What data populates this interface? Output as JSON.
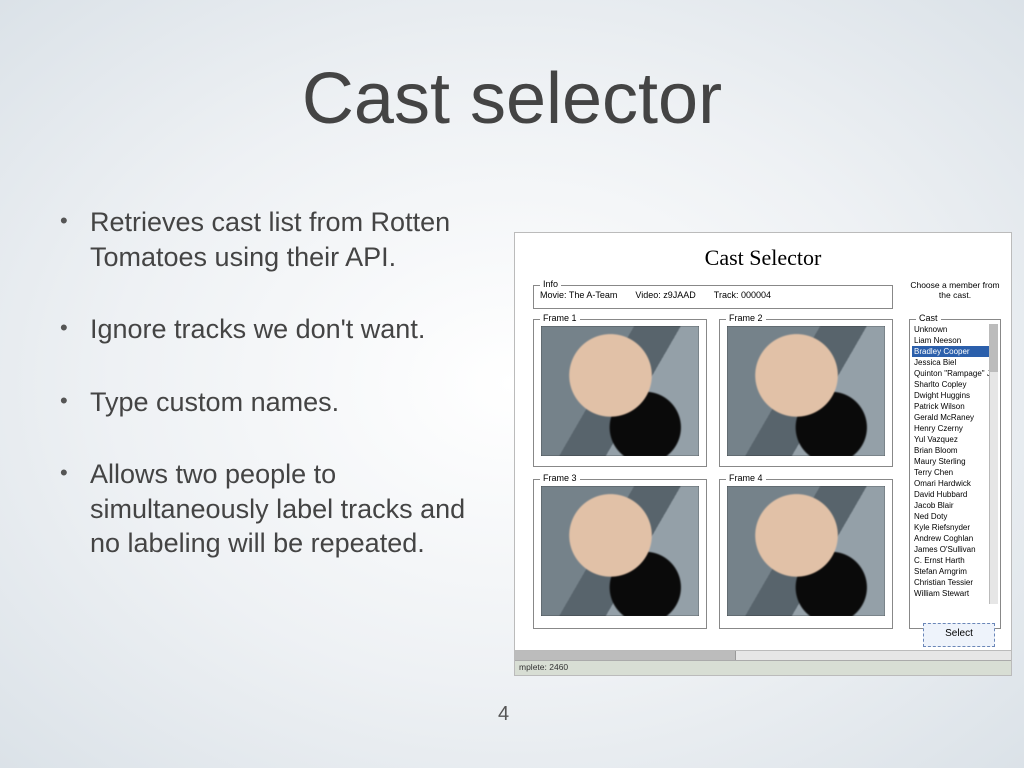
{
  "title": "Cast selector",
  "bullets": [
    "Retrieves cast list from Rotten Tomatoes using their API.",
    "Ignore tracks we don't want.",
    "Type custom names.",
    "Allows two people to simultaneously label tracks and no labeling will be repeated."
  ],
  "page_number": "4",
  "app": {
    "title": "Cast Selector",
    "info_label": "Info",
    "movie_label": "Movie:",
    "movie_value": "The A-Team",
    "video_label": "Video:",
    "video_value": "z9JAAD",
    "track_label": "Track:",
    "track_value": "000004",
    "cast_prompt": "Choose a member from the cast.",
    "frame_labels": [
      "Frame 1",
      "Frame 2",
      "Frame 3",
      "Frame 4"
    ],
    "cast_box_label": "Cast",
    "cast_list": [
      "Unknown",
      "Liam Neeson",
      "Bradley Cooper",
      "Jessica Biel",
      "Quinton \"Rampage\" Ja",
      "Sharlto Copley",
      "Dwight Huggins",
      "Patrick Wilson",
      "Gerald McRaney",
      "Henry Czerny",
      "Yul Vazquez",
      "Brian Bloom",
      "Maury Sterling",
      "Terry Chen",
      "Omari Hardwick",
      "David Hubbard",
      "Jacob Blair",
      "Ned Doty",
      "Kyle Riefsnyder",
      "Andrew Coghlan",
      "James O'Sullivan",
      "C. Ernst Harth",
      "Stefan Arngrim",
      "Christian Tessier",
      "William Stewart"
    ],
    "cast_selected_index": 2,
    "select_button": "Select",
    "status_bar": "mplete: 2460"
  }
}
